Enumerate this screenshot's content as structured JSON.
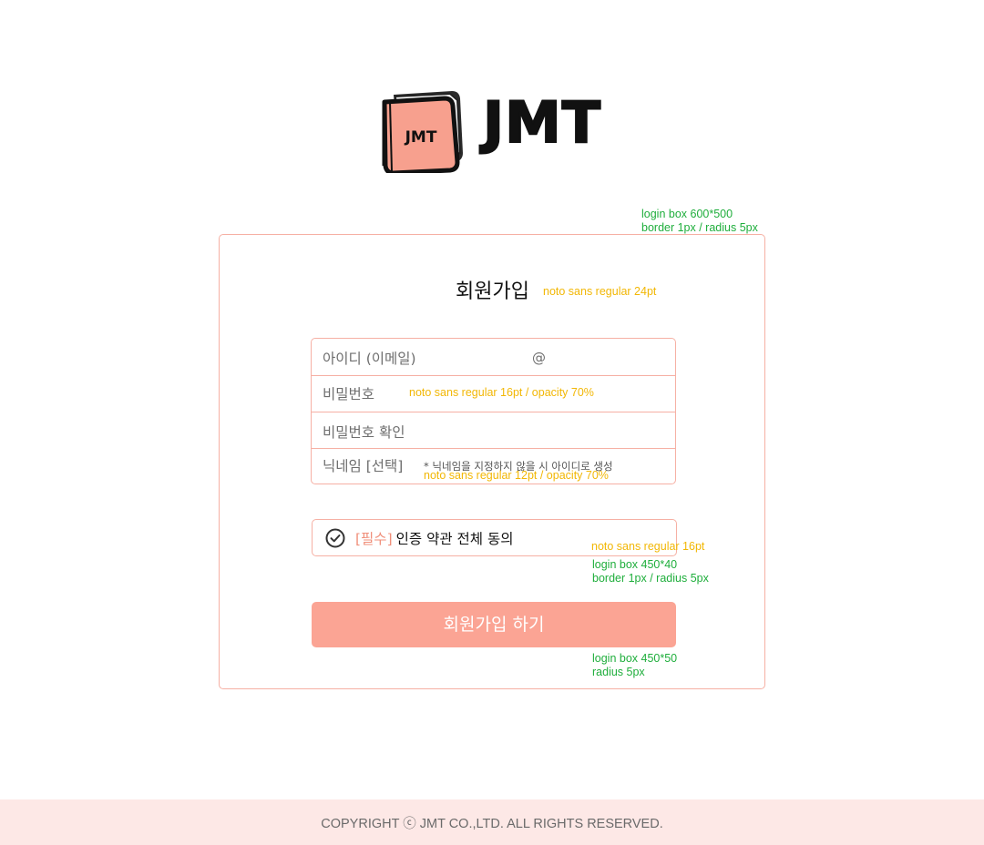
{
  "brand": {
    "logo_text": "JMT",
    "book_label": "JMT",
    "accent_color": "#fba494",
    "border_color": "#f6b0a4",
    "footer_bg": "#fde8e6"
  },
  "annotations": {
    "box_spec_line1": "login box 600*500",
    "box_spec_line2": "border 1px / radius 5px",
    "title_spec": "noto sans regular 24pt",
    "field_spec": "noto sans regular 16pt / opacity 70%",
    "note_spec": "noto sans regular 12pt / opacity 70%",
    "agree_font_spec": "noto sans regular 16pt",
    "agree_box_line1": "login box 450*40",
    "agree_box_line2": "border 1px / radius 5px",
    "button_line1": "login box 450*50",
    "button_line2": "radius 5px"
  },
  "form": {
    "title": "회원가입",
    "fields": {
      "id_label": "아이디 (이메일)",
      "at_sign": "@",
      "password_label": "비밀번호",
      "password_confirm_label": "비밀번호 확인",
      "nickname_label": "닉네임 [선택]",
      "nickname_note": "* 닉네임을 지정하지 않을 시 아이디로 생성"
    },
    "agree": {
      "required_tag": "[필수]",
      "label": "인증 약관 전체 동의",
      "icon": "check-circle-icon"
    },
    "submit_label": "회원가입 하기"
  },
  "footer": {
    "copyright": "COPYRIGHT ⓒ JMT CO.,LTD. ALL RIGHTS RESERVED."
  }
}
